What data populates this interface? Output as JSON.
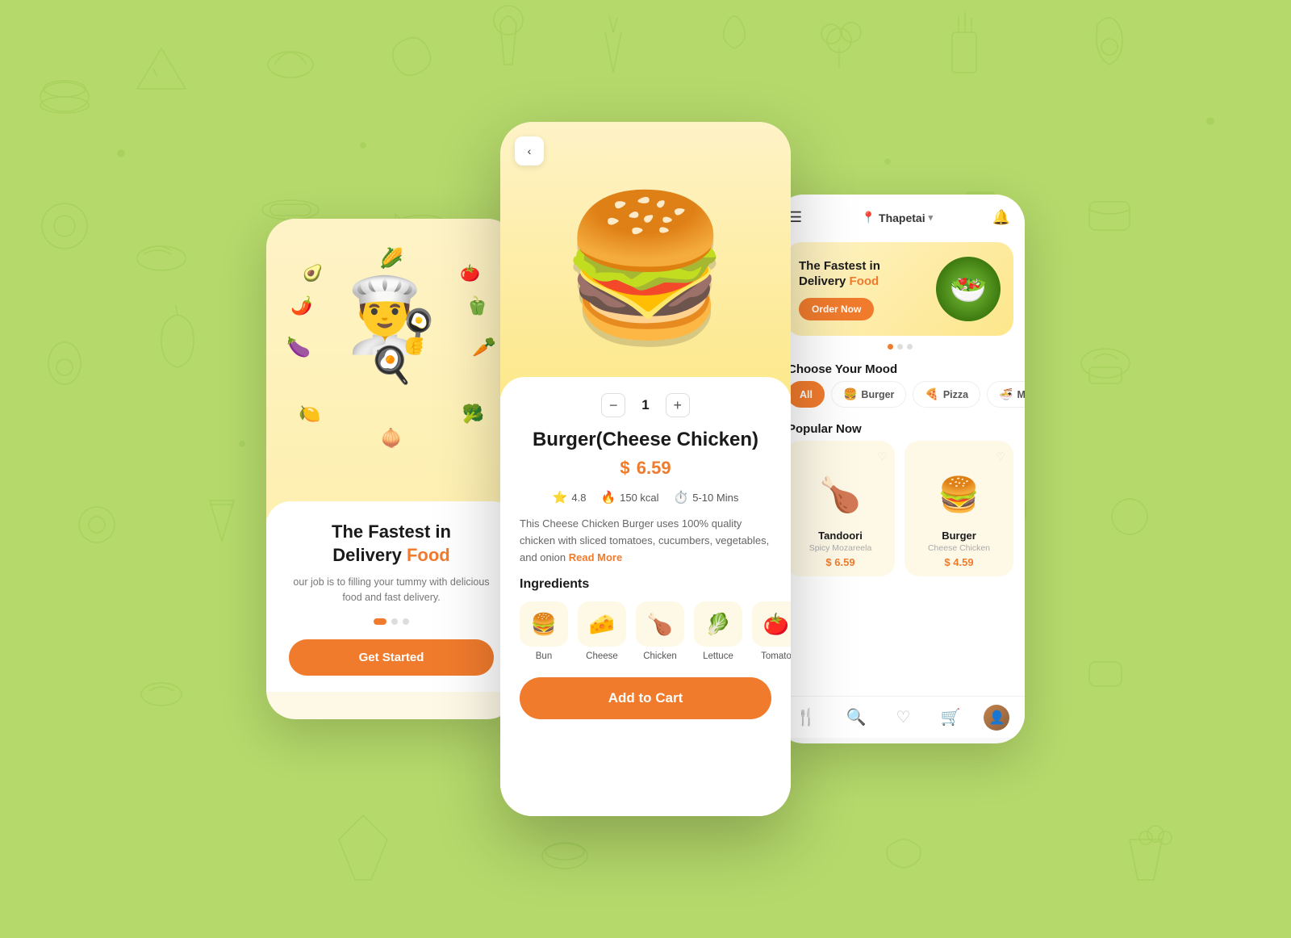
{
  "background": {
    "color": "#b5d96b"
  },
  "phone1": {
    "title_line1": "The Fastest in",
    "title_line2": "Delivery ",
    "title_accent": "Food",
    "subtitle": "our job is to filling your tummy with delicious food and fast delivery.",
    "cta_label": "Get Started",
    "dots": [
      "active",
      "inactive",
      "inactive"
    ]
  },
  "phone2": {
    "back_label": "‹",
    "quantity": "1",
    "product_name": "Burger(Cheese Chicken)",
    "price": "6.59",
    "currency": "$",
    "rating": "4.8",
    "calories": "150 kcal",
    "time": "5-10 Mins",
    "description": "This Cheese Chicken Burger uses 100% quality chicken with sliced tomatoes, cucumbers, vegetables, and onion",
    "read_more": "Read More",
    "ingredients_title": "Ingredients",
    "ingredients": [
      {
        "name": "Bun",
        "emoji": "🍔"
      },
      {
        "name": "Cheese",
        "emoji": "🧀"
      },
      {
        "name": "Chicken",
        "emoji": "🍗"
      },
      {
        "name": "Lettuce",
        "emoji": "🥬"
      },
      {
        "name": "Tomato",
        "emoji": "🍅"
      }
    ],
    "add_to_cart": "Add to Cart"
  },
  "phone3": {
    "header": {
      "location": "Thapetai",
      "chevron": "▾"
    },
    "banner": {
      "title_line1": "The Fastest in",
      "title_line2": "Delivery ",
      "title_accent": "Food",
      "cta": "Order Now"
    },
    "section_mood": "Choose Your Mood",
    "mood_chips": [
      {
        "label": "All",
        "active": true,
        "icon": ""
      },
      {
        "label": "Burger",
        "active": false,
        "icon": "🍔"
      },
      {
        "label": "Pizza",
        "active": false,
        "icon": "🍕"
      },
      {
        "label": "More",
        "active": false,
        "icon": "🍜"
      }
    ],
    "section_popular": "Popular Now",
    "popular_items": [
      {
        "name": "Tandoori",
        "sub": "Spicy Mozareela",
        "price": "6.59",
        "currency": "$",
        "emoji": "🍗"
      },
      {
        "name": "Burger",
        "sub": "Cheese Chicken",
        "price": "4.59",
        "currency": "$",
        "emoji": "🍔"
      }
    ],
    "nav": {
      "icons": [
        "🍴",
        "🔍",
        "♡",
        "🛒"
      ]
    }
  }
}
